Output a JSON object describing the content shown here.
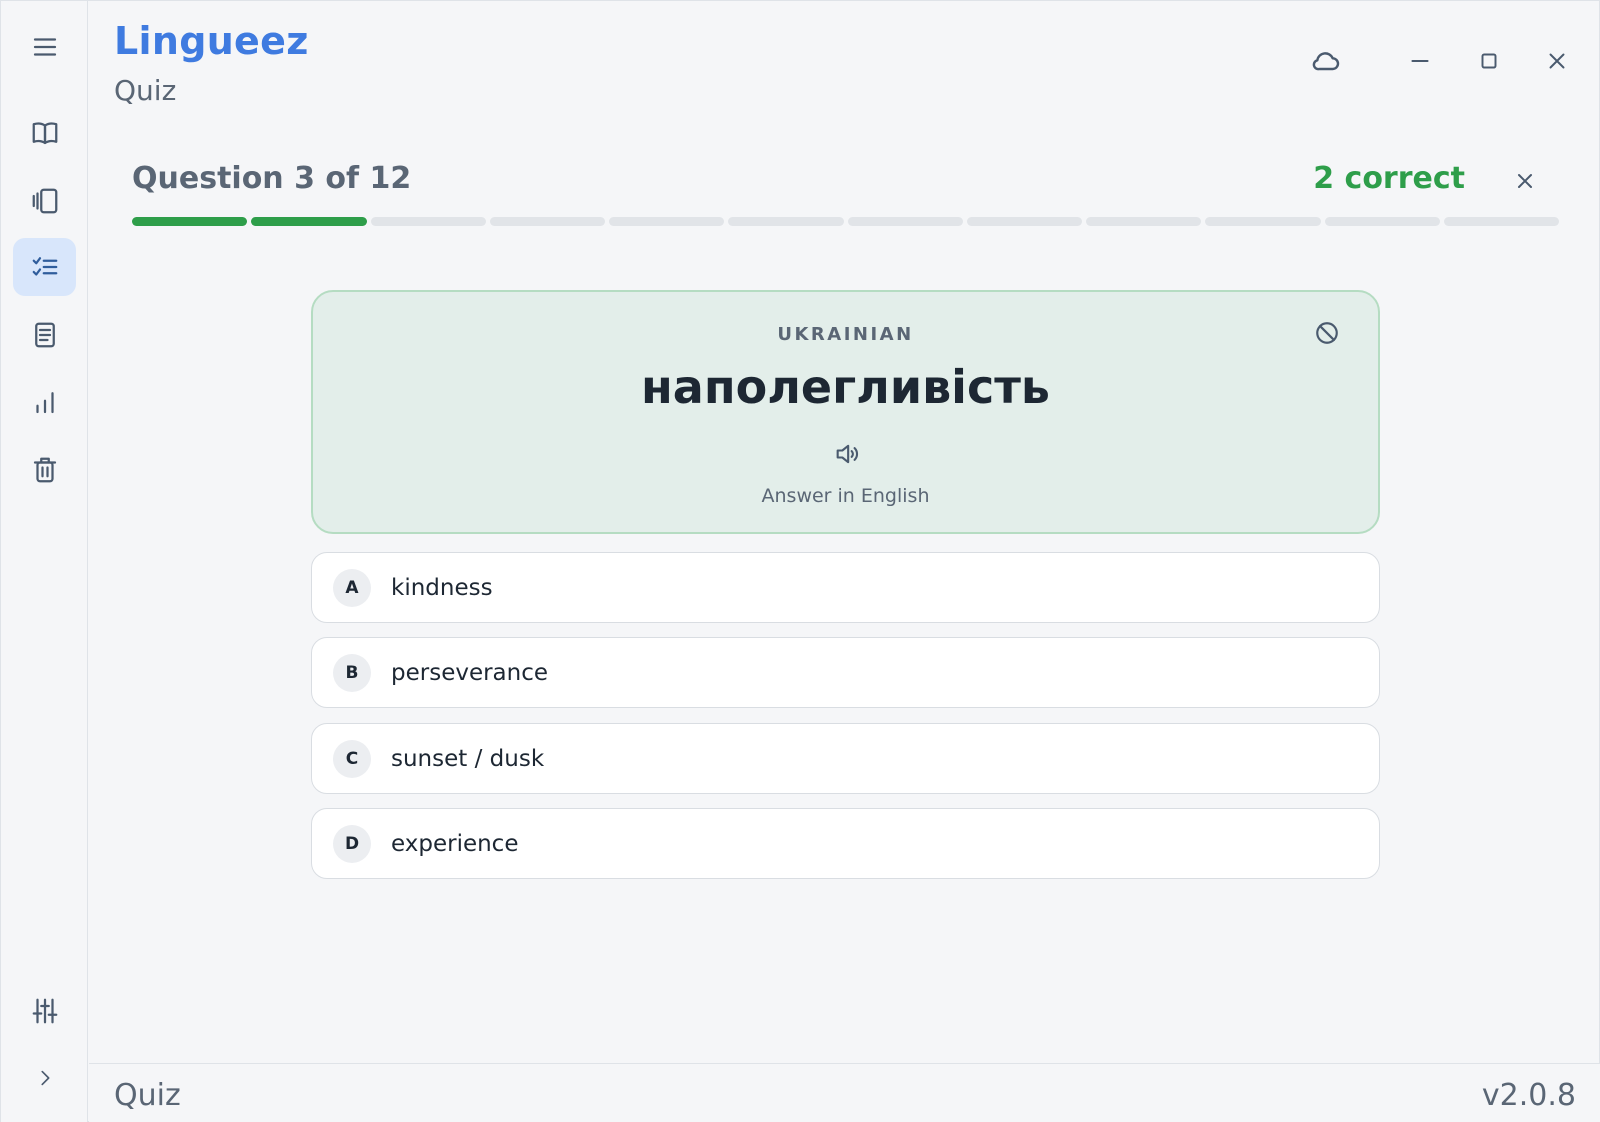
{
  "app": {
    "title": "Lingueez",
    "subtitle": "Quiz"
  },
  "sidebar": {
    "items": [
      {
        "icon": "menu-icon"
      },
      {
        "icon": "book-icon"
      },
      {
        "icon": "flashcards-icon"
      },
      {
        "icon": "quiz-checklist-icon",
        "active": true
      },
      {
        "icon": "notes-icon"
      },
      {
        "icon": "stats-chart-icon"
      },
      {
        "icon": "trash-icon"
      },
      {
        "icon": "settings-sliders-icon"
      },
      {
        "icon": "chevron-right-icon"
      }
    ]
  },
  "quiz": {
    "question_label": "Question 3 of 12",
    "correct_label": "2 correct",
    "total_questions": 12,
    "completed": 2
  },
  "card": {
    "language": "UKRAINIAN",
    "word": "наполегливість",
    "hint": "Answer in English"
  },
  "options": [
    {
      "letter": "A",
      "text": "kindness"
    },
    {
      "letter": "B",
      "text": "perseverance"
    },
    {
      "letter": "C",
      "text": "sunset / dusk"
    },
    {
      "letter": "D",
      "text": "experience"
    }
  ],
  "footer": {
    "left": "Quiz",
    "version": "v2.0.8"
  },
  "colors": {
    "brand": "#3f7be0",
    "success": "#2e9e4a",
    "active_nav": "#d8e6fb"
  }
}
